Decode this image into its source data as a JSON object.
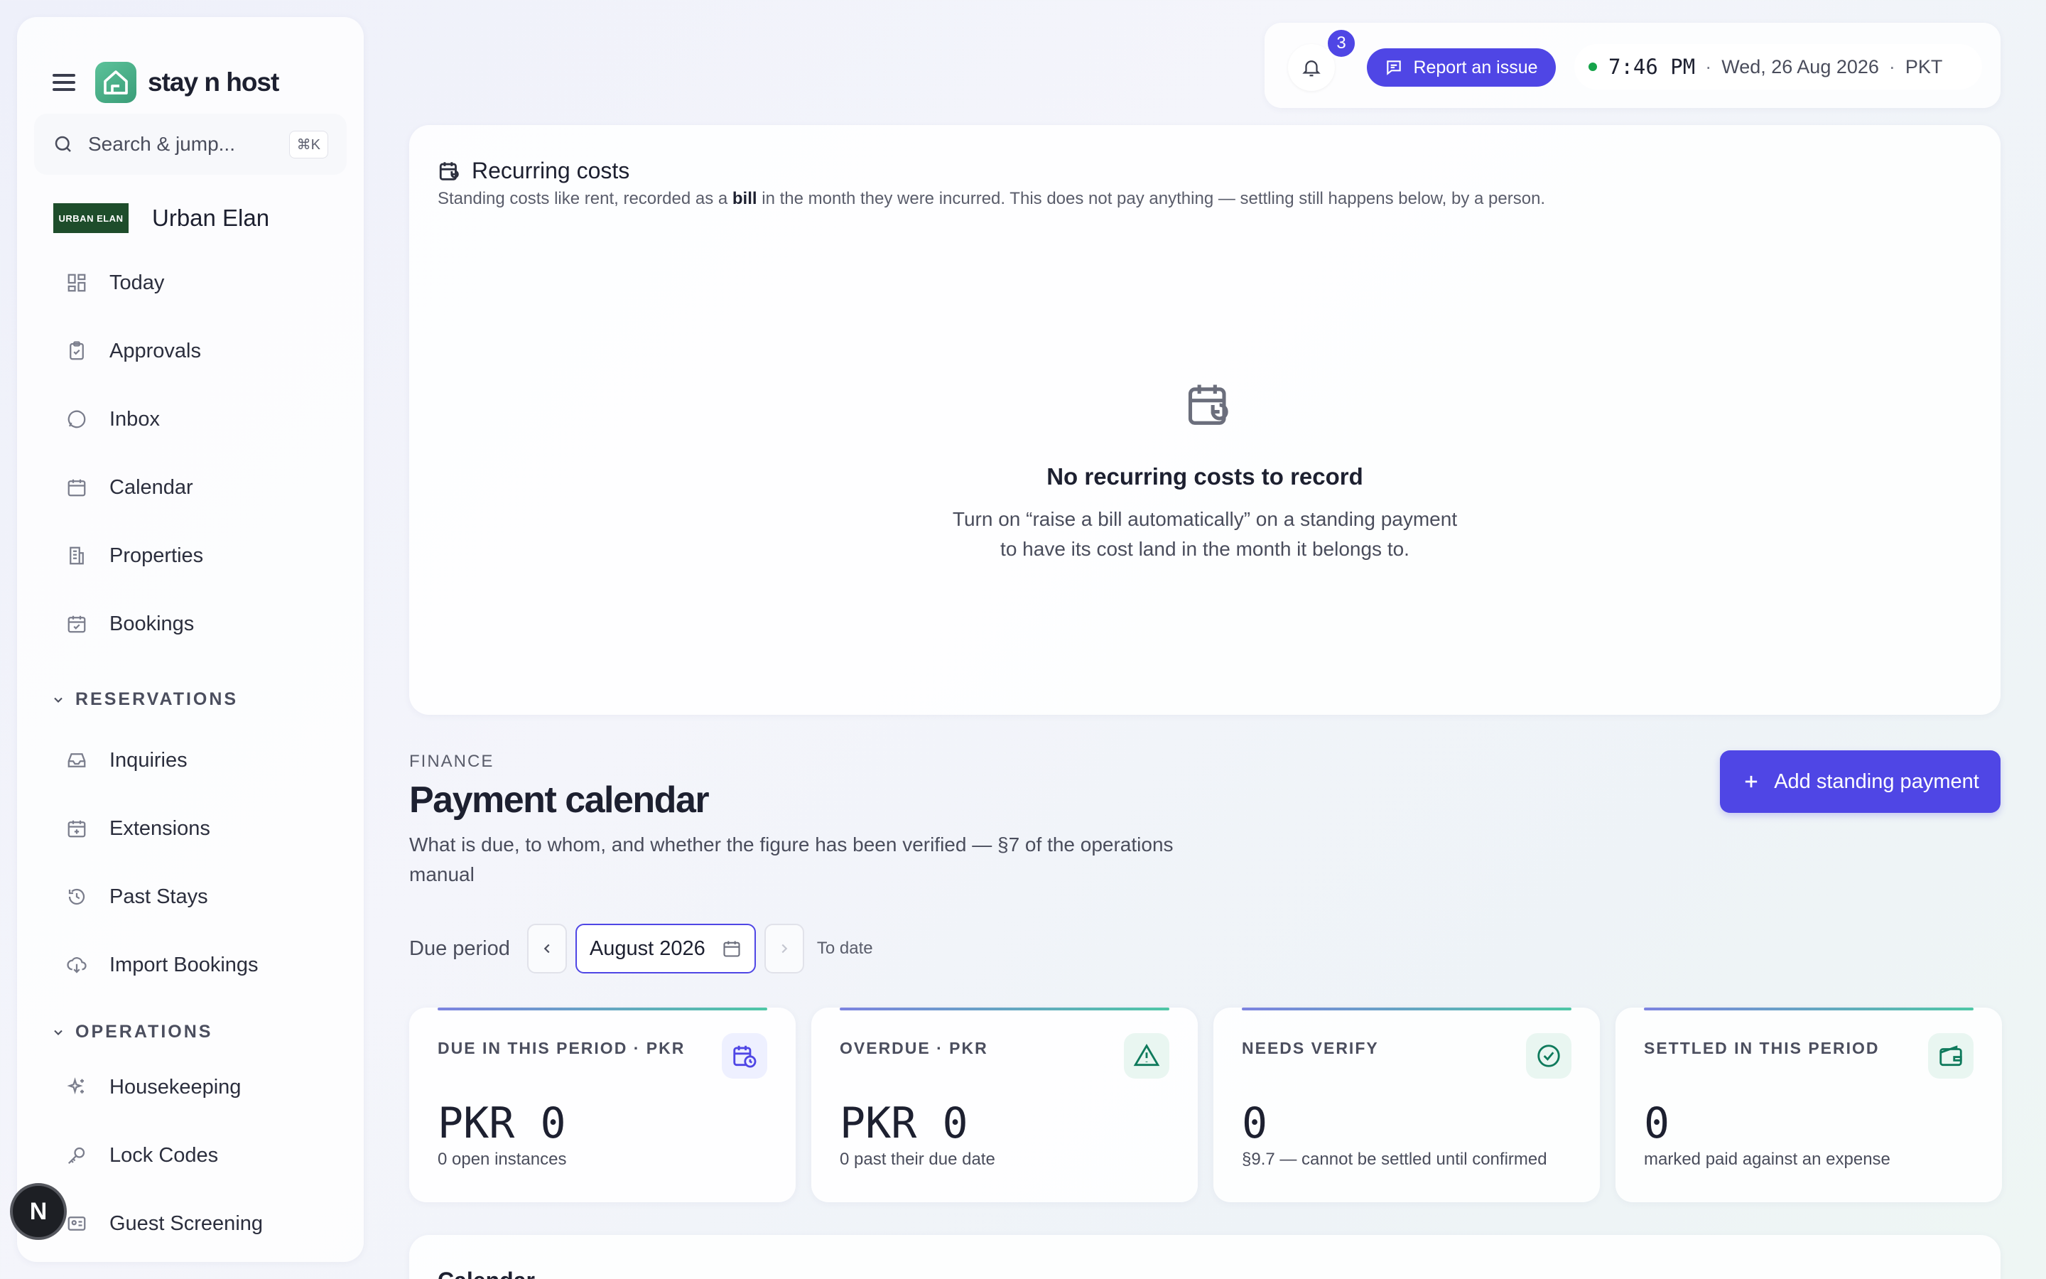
{
  "brand": {
    "name": "stay n host"
  },
  "search": {
    "placeholder": "Search & jump...",
    "shortcut": "⌘K"
  },
  "workspace": {
    "logo_text": "URBAN ELAN",
    "name": "Urban Elan"
  },
  "nav": {
    "main": [
      {
        "label": "Today",
        "icon": "dashboard-icon"
      },
      {
        "label": "Approvals",
        "icon": "clipboard-check-icon"
      },
      {
        "label": "Inbox",
        "icon": "message-circle-icon"
      },
      {
        "label": "Calendar",
        "icon": "calendar-icon"
      },
      {
        "label": "Properties",
        "icon": "building-icon"
      },
      {
        "label": "Bookings",
        "icon": "calendar-check-icon"
      }
    ],
    "reservations_heading": "RESERVATIONS",
    "reservations": [
      {
        "label": "Inquiries",
        "icon": "inbox-tray-icon"
      },
      {
        "label": "Extensions",
        "icon": "calendar-plus-icon"
      },
      {
        "label": "Past Stays",
        "icon": "history-icon"
      },
      {
        "label": "Import Bookings",
        "icon": "cloud-download-icon"
      }
    ],
    "operations_heading": "OPERATIONS",
    "operations": [
      {
        "label": "Housekeeping",
        "icon": "sparkles-icon"
      },
      {
        "label": "Lock Codes",
        "icon": "key-icon"
      },
      {
        "label": "Guest Screening",
        "icon": "id-card-icon"
      }
    ]
  },
  "user": {
    "initial": "N"
  },
  "topbar": {
    "notification_count": "3",
    "report_label": "Report an issue",
    "time": "7:46 PM",
    "date": "Wed, 26 Aug 2026",
    "timezone": "PKT",
    "status_color": "#16a34a"
  },
  "recurring": {
    "title": "Recurring costs",
    "subtitle_before": "Standing costs like rent, recorded as a ",
    "subtitle_bold": "bill",
    "subtitle_after": " in the month they were incurred. This does not pay anything — settling still happens below, by a person.",
    "empty_title": "No recurring costs to record",
    "empty_line1": "Turn on “raise a bill automatically” on a standing payment",
    "empty_line2": "to have its cost land in the month it belongs to."
  },
  "finance": {
    "eyebrow": "FINANCE",
    "title": "Payment calendar",
    "description": "What is due, to whom, and whether the figure has been verified — §7 of the operations manual",
    "add_label": "Add standing payment",
    "period_label": "Due period",
    "period_value": "August 2026",
    "to_date": "To date"
  },
  "stats": [
    {
      "label": "DUE IN THIS PERIOD · PKR",
      "value": "PKR 0",
      "note": "0 open instances",
      "icon": "calendar-clock-icon",
      "color": "#4f46e5",
      "bg": "#eef0ff"
    },
    {
      "label": "OVERDUE · PKR",
      "value": "PKR 0",
      "note": "0 past their due date",
      "icon": "alert-triangle-icon",
      "color": "#0f7a5c",
      "bg": "#e9f6f1"
    },
    {
      "label": "NEEDS VERIFY",
      "value": "0",
      "note": "§9.7 — cannot be settled until confirmed",
      "icon": "check-circle-icon",
      "color": "#0f7a5c",
      "bg": "#e9f6f1"
    },
    {
      "label": "SETTLED IN THIS PERIOD",
      "value": "0",
      "note": "marked paid against an expense",
      "icon": "wallet-icon",
      "color": "#0f7a5c",
      "bg": "#e9f6f1"
    }
  ],
  "calendar_section": {
    "title": "Calendar"
  },
  "colors": {
    "accent": "#4f46e5",
    "brand_green": "#3a9d78"
  }
}
